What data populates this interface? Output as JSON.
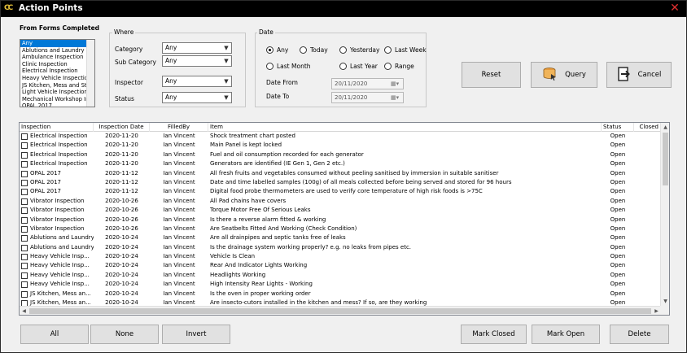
{
  "window": {
    "title": "Action Points",
    "app_icon": "CC"
  },
  "forms": {
    "label": "From Forms Completed",
    "items": [
      "Any",
      "Ablutions and Laundry",
      "Ambulance Inspection",
      "Clinic Inspection",
      "Electrical Inspection",
      "Heavy Vehicle Inspection",
      "JS Kitchen, Mess and St",
      "Light Vehicle Inspection",
      "Mechanical Workshop In",
      "OPAL 2017"
    ],
    "selected": 0
  },
  "where": {
    "title": "Where",
    "category_label": "Category",
    "category_value": "Any",
    "subcategory_label": "Sub Category",
    "subcategory_value": "Any",
    "inspector_label": "Inspector",
    "inspector_value": "Any",
    "status_label": "Status",
    "status_value": "Any"
  },
  "date": {
    "title": "Date",
    "options": [
      "Any",
      "Today",
      "Yesterday",
      "Last Week",
      "Last Month",
      "Last Year",
      "Range"
    ],
    "selected": "Any",
    "from_label": "Date From",
    "from_value": "20/11/2020",
    "to_label": "Date To",
    "to_value": "20/11/2020"
  },
  "buttons": {
    "reset": "Reset",
    "query": "Query",
    "cancel": "Cancel",
    "all": "All",
    "none": "None",
    "invert": "Invert",
    "mark_closed": "Mark Closed",
    "mark_open": "Mark Open",
    "delete": "Delete"
  },
  "grid": {
    "columns": [
      "Inspection",
      "Inspection Date",
      "FilledBy",
      "Item",
      "Status",
      "Closed"
    ],
    "rows": [
      [
        "Electrical Inspection",
        "2020-11-20",
        "Ian Vincent",
        "Shock treatment chart posted",
        "Open",
        ""
      ],
      [
        "Electrical Inspection",
        "2020-11-20",
        "Ian Vincent",
        "Main Panel is kept locked",
        "Open",
        ""
      ],
      [
        "Electrical Inspection",
        "2020-11-20",
        "Ian Vincent",
        "Fuel and oil consumption recorded for each generator",
        "Open",
        ""
      ],
      [
        "Electrical Inspection",
        "2020-11-20",
        "Ian Vincent",
        "Generators are identified (IE Gen 1, Gen 2 etc.)",
        "Open",
        ""
      ],
      [
        "OPAL 2017",
        "2020-11-12",
        "Ian Vincent",
        "All fresh fruits and vegetables consumed without peeling sanitised by immersion in suitable sanitiser",
        "Open",
        ""
      ],
      [
        "OPAL 2017",
        "2020-11-12",
        "Ian Vincent",
        "Date and time labelled samples (100g) of all meals collected before being served and stored for 96 hours",
        "Open",
        ""
      ],
      [
        "OPAL 2017",
        "2020-11-12",
        "Ian Vincent",
        "Digital food probe thermometers are used to verify core temperature of high risk foods is >75C",
        "Open",
        ""
      ],
      [
        "Vibrator Inspection",
        "2020-10-26",
        "Ian Vincent",
        "All Pad chains have covers",
        "Open",
        ""
      ],
      [
        "Vibrator Inspection",
        "2020-10-26",
        "Ian Vincent",
        "Torque Motor Free Of Serious Leaks",
        "Open",
        ""
      ],
      [
        "Vibrator Inspection",
        "2020-10-26",
        "Ian Vincent",
        "Is there a reverse alarm fitted & working",
        "Open",
        ""
      ],
      [
        "Vibrator Inspection",
        "2020-10-26",
        "Ian Vincent",
        "Are Seatbelts Fitted And Working (Check Condition)",
        "Open",
        ""
      ],
      [
        "Ablutions and Laundry",
        "2020-10-24",
        "Ian Vincent",
        "Are all drainpipes and septic tanks free of leaks",
        "Open",
        ""
      ],
      [
        "Ablutions and Laundry",
        "2020-10-24",
        "Ian Vincent",
        "Is the drainage system working properly? e.g. no leaks from pipes etc.",
        "Open",
        ""
      ],
      [
        "Heavy Vehicle Insp...",
        "2020-10-24",
        "Ian Vincent",
        "Vehicle Is Clean",
        "Open",
        ""
      ],
      [
        "Heavy Vehicle Insp...",
        "2020-10-24",
        "Ian Vincent",
        "Rear And Indicator Lights Working",
        "Open",
        ""
      ],
      [
        "Heavy Vehicle Insp...",
        "2020-10-24",
        "Ian Vincent",
        "Headlights Working",
        "Open",
        ""
      ],
      [
        "Heavy Vehicle Insp...",
        "2020-10-24",
        "Ian Vincent",
        "High Intensity Rear Lights - Working",
        "Open",
        ""
      ],
      [
        "JS Kitchen, Mess an...",
        "2020-10-24",
        "Ian Vincent",
        "Is the oven in proper working order",
        "Open",
        ""
      ],
      [
        "JS Kitchen, Mess an...",
        "2020-10-24",
        "Ian Vincent",
        "Are insecto-cutors installed in the kitchen and mess? If so, are they working",
        "Open",
        ""
      ]
    ]
  },
  "colors": {
    "selection": "#0078d7",
    "titlebar": "#000000",
    "icon_accent": "#e8c33a",
    "close": "#e03030"
  },
  "icons": {
    "close": "close-icon",
    "query": "database-query-icon",
    "cancel": "exit-door-icon",
    "calendar": "calendar-icon"
  }
}
